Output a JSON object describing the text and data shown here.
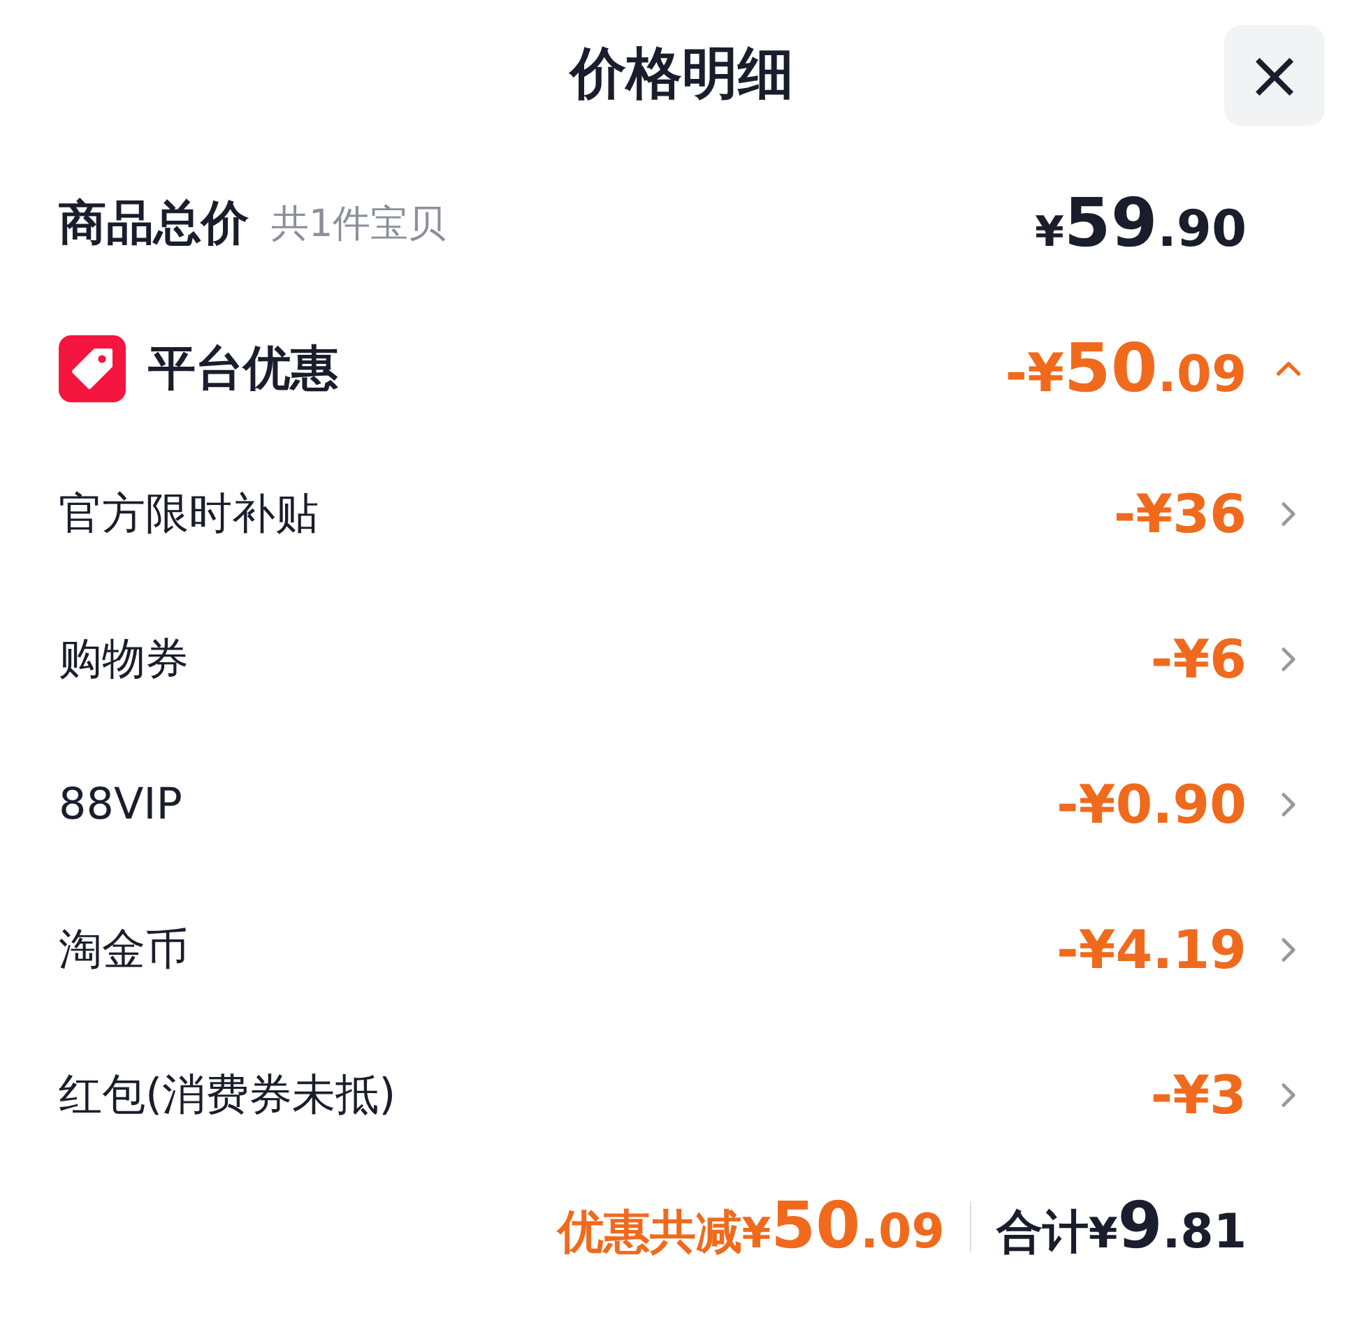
{
  "header": {
    "title": "价格明细",
    "close": "×"
  },
  "goods_total": {
    "label": "商品总价",
    "count": "共1件宝贝",
    "price": "¥59.90"
  },
  "platform_discount": {
    "label": "平台优惠",
    "amount": "-¥50.09",
    "expanded": true
  },
  "discounts": [
    {
      "label": "官方限时补贴",
      "amount": "-¥36"
    },
    {
      "label": "购物券",
      "amount": "-¥6"
    },
    {
      "label": "88VIP",
      "amount": "-¥0.90"
    },
    {
      "label": "淘金币",
      "amount": "-¥4.19"
    },
    {
      "label": "红包(消费券未抵)",
      "amount": "-¥3"
    }
  ],
  "footer": {
    "discount_label": "优惠共减",
    "discount_amount": "¥50.09",
    "total_label": "合计",
    "total_amount": "¥9.81"
  }
}
